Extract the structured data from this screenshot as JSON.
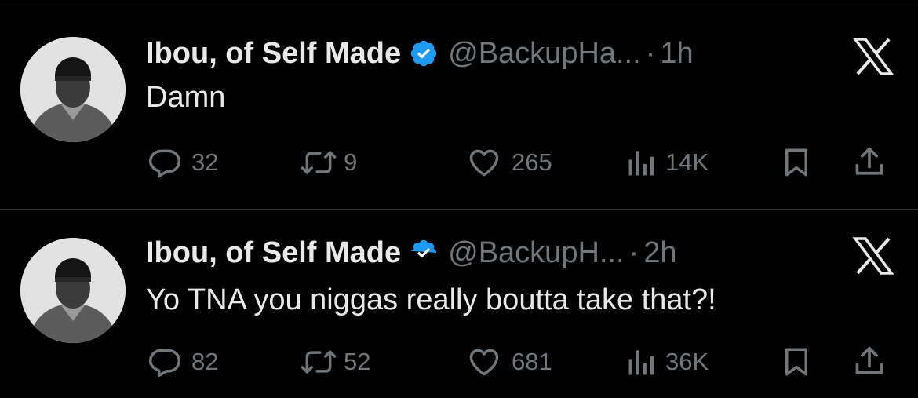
{
  "colors": {
    "background": "#000000",
    "text_primary": "#e7e9ea",
    "text_secondary": "#71767b",
    "verified_badge": "#1d9bf0",
    "divider": "#2f3336"
  },
  "tweets": [
    {
      "display_name": "Ibou, of Self Made",
      "verified": true,
      "handle": "@BackupHa...",
      "separator": "·",
      "time": "1h",
      "text": "Damn",
      "replies": "32",
      "reposts": "9",
      "likes": "265",
      "views": "14K"
    },
    {
      "display_name": "Ibou, of Self Made",
      "verified": true,
      "handle": "@BackupH...",
      "separator": "·",
      "time": "2h",
      "text": "Yo TNA you niggas really boutta take that?!",
      "replies": "82",
      "reposts": "52",
      "likes": "681",
      "views": "36K"
    }
  ],
  "icons": {
    "reply": "reply-icon",
    "repost": "repost-icon",
    "like": "heart-icon",
    "views": "analytics-icon",
    "bookmark": "bookmark-icon",
    "share": "share-icon",
    "platform_logo": "x-logo-icon",
    "verified": "verified-badge-icon"
  }
}
